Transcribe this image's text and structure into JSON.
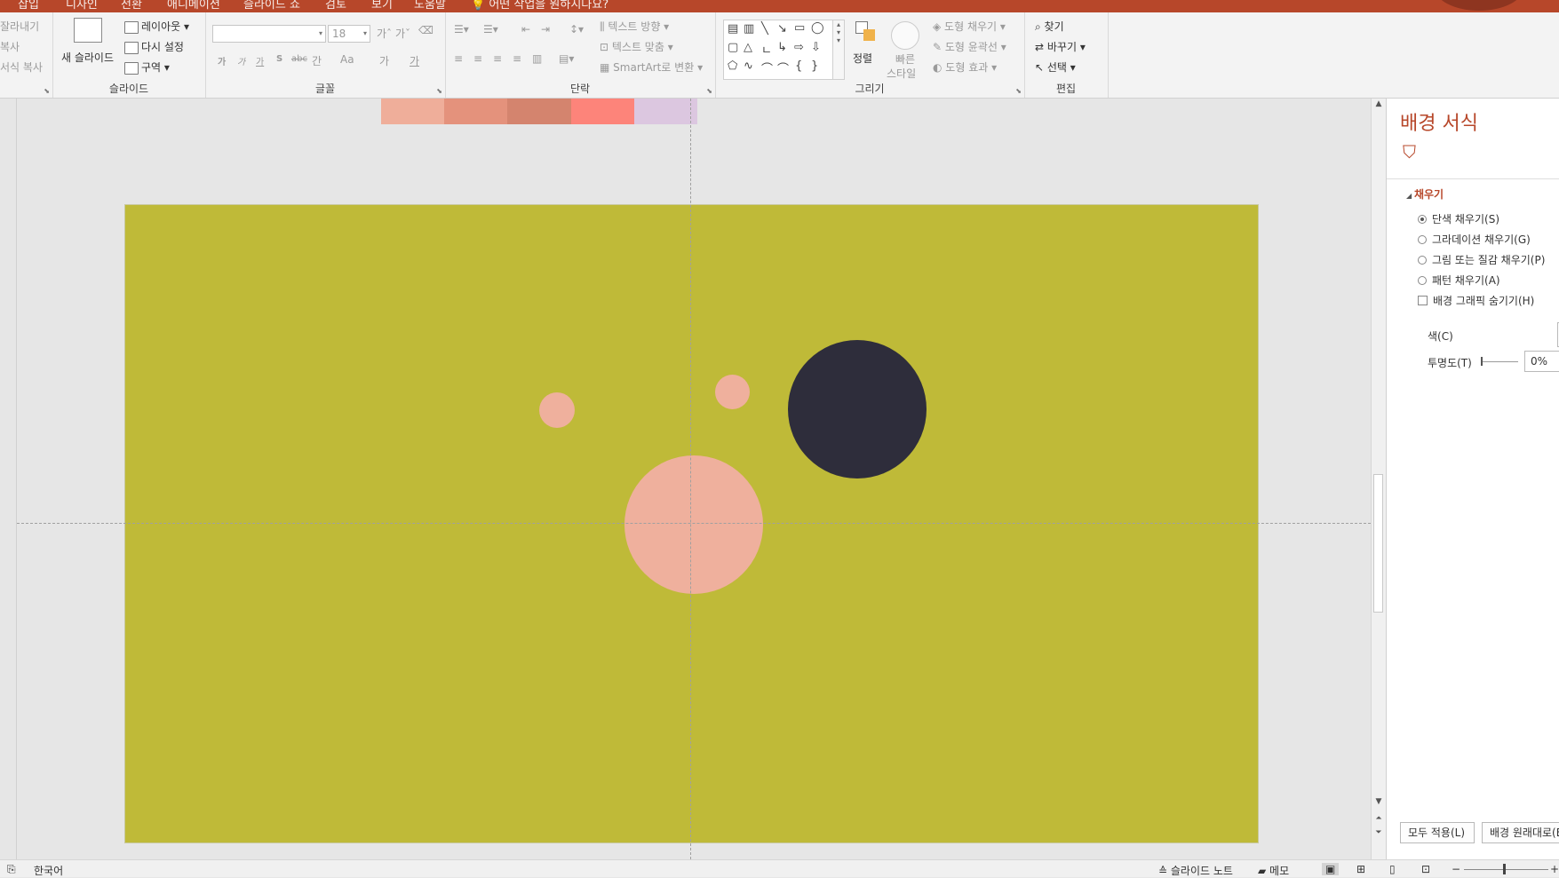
{
  "menu_tabs": [
    "삽입",
    "디자인",
    "전환",
    "애니메이션",
    "슬라이드 쇼",
    "검토",
    "보기",
    "도움말",
    "어떤 작업을 원하시나요?"
  ],
  "ribbon": {
    "clipboard": {
      "cut": "잘라내기",
      "copy": "복사",
      "format_painter": "서식 복사"
    },
    "slides": {
      "label": "슬라이드",
      "new_slide": "새 슬라이드",
      "layout": "레이아웃",
      "reset": "다시 설정",
      "section": "구역"
    },
    "font": {
      "label": "글꼴",
      "font_name": "",
      "font_size": "18",
      "bold": "가",
      "italic": "가",
      "underline": "가",
      "shadow": "S",
      "strike": "abc",
      "spacing": "간",
      "case": "Aa",
      "highlight": "가",
      "color": "가"
    },
    "paragraph": {
      "label": "단락",
      "text_direction": "텍스트 방향",
      "align_text": "텍스트 맞춤",
      "smartart": "SmartArt로 변환"
    },
    "drawing": {
      "label": "그리기",
      "arrange": "정렬",
      "quick_styles_1": "빠른",
      "quick_styles_2": "스타일",
      "shape_fill": "도형 채우기",
      "shape_outline": "도형 윤곽선",
      "shape_effects": "도형 효과"
    },
    "editing": {
      "label": "편집",
      "find": "찾기",
      "replace": "바꾸기",
      "select": "선택"
    }
  },
  "palette_colors": [
    "#efae9a",
    "#e4927c",
    "#d4846e",
    "#fd847a",
    "#dcc7e0"
  ],
  "slide": {
    "background": "#bfba38",
    "circles": [
      {
        "name": "small-pink-circle-left",
        "color": "#efb09d"
      },
      {
        "name": "small-pink-circle-top",
        "color": "#efb09d"
      },
      {
        "name": "large-pink-circle",
        "color": "#efb09d"
      },
      {
        "name": "dark-navy-circle",
        "color": "#2e2d3b"
      }
    ]
  },
  "format_pane": {
    "title": "배경 서식",
    "section": "채우기",
    "options": {
      "solid": "단색 채우기(S)",
      "gradient": "그라데이션 채우기(G)",
      "picture": "그림 또는 질감 채우기(P)",
      "pattern": "패턴 채우기(A)",
      "hide_graphics": "배경 그래픽 숨기기(H)"
    },
    "color_label": "색(C)",
    "transparency_label": "투명도(T)",
    "transparency_value": "0%",
    "apply_all": "모두 적용(L)",
    "reset_background": "배경 원래대로(B)"
  },
  "status": {
    "language": "한국어",
    "notes": "슬라이드 노트",
    "comments": "메모"
  },
  "colors": {
    "accent": "#b7472a"
  }
}
